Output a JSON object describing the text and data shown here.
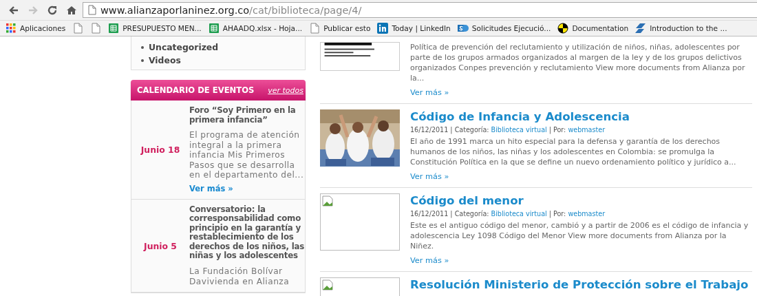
{
  "browser": {
    "nav": [
      {
        "kind": "back",
        "disabled": false
      },
      {
        "kind": "forward",
        "disabled": true
      },
      {
        "kind": "reload",
        "disabled": false
      },
      {
        "kind": "home",
        "disabled": false
      }
    ],
    "address": {
      "host": "www.alianzaporlaninez.org.co",
      "path": "/cat/biblioteca/page/4/"
    },
    "bookmarks": [
      {
        "kind": "apps",
        "label": "Aplicaciones"
      },
      {
        "kind": "page"
      },
      {
        "kind": "page"
      },
      {
        "kind": "sheet",
        "label": "PRESUPUESTO MEN..."
      },
      {
        "kind": "sheet",
        "label": "AHAADQ.xlsx - Hoja..."
      },
      {
        "kind": "page",
        "label": "Publicar esto"
      },
      {
        "kind": "linkedin",
        "label": "Today | LinkedIn"
      },
      {
        "kind": "sharepoint",
        "label": "Solicitudes Ejecució..."
      },
      {
        "kind": "target",
        "label": "Documentation"
      },
      {
        "kind": "stripes",
        "label": "Introduction to the ..."
      }
    ]
  },
  "sidebar": {
    "categories": [
      "Uncategorized",
      "Videos"
    ],
    "calendar": {
      "title": "CALENDARIO DE EVENTOS",
      "link": "ver todos",
      "events": [
        {
          "date": "Junio 18",
          "title": "Foro “Soy Primero en la primera infancia”",
          "text": "El programa de atención integral a la primera infancia Mis Primeros Pasos que se desarrolla en el departamento del...",
          "more": "Ver más »"
        },
        {
          "date": "Junio 5",
          "title": "Conversatorio: la corresponsabilidad como principio en la garantía y restablecimiento de los derechos de los niños, las niñas y los adolescentes",
          "text": "La Fundación Bolívar Davivienda en Alianza"
        }
      ]
    }
  },
  "posts": [
    {
      "kind": "document",
      "text": "Política de prevención del reclutamiento y utilización de niños, niñas, adolescentes por parte de los grupos armados organizados al margen de la ley y de los grupos delictivos organizados Conpes prevención y reclutamiento View more documents from Alianza por la...",
      "more": "Ver más »"
    },
    {
      "title": "Código de Infancia y Adolescencia",
      "meta": {
        "date": "16/12/2011",
        "separator": "|",
        "category_label": "Categoría:",
        "category": "Biblioteca virtual",
        "author_label": "Por:",
        "author": "webmaster"
      },
      "text": "El año de 1991 marca un hito especial para la defensa y garantía de los derechos humanos de los niños, las niñas y los adolescentes en Colombia: se promulga la Constitución Política en la que se define un nuevo ordenamiento político y jurídico a...",
      "more": "Ver más »"
    },
    {
      "kind": "broken",
      "title": "Código del menor",
      "meta": {
        "date": "16/12/2011",
        "separator": "|",
        "category_label": "Categoría:",
        "category": "Biblioteca virtual",
        "author_label": "Por:",
        "author": "webmaster"
      },
      "text": "Este es el antiguo código del menor,  cambió y a partir de 2006 es el código de infancia y adolescencia Ley 1098 Código del Menor View more documents from Alianza por la Niñez.",
      "more": "Ver más »"
    },
    {
      "kind": "broken",
      "title": "Resolución Ministerio de Protección sobre el Trabajo"
    }
  ]
}
